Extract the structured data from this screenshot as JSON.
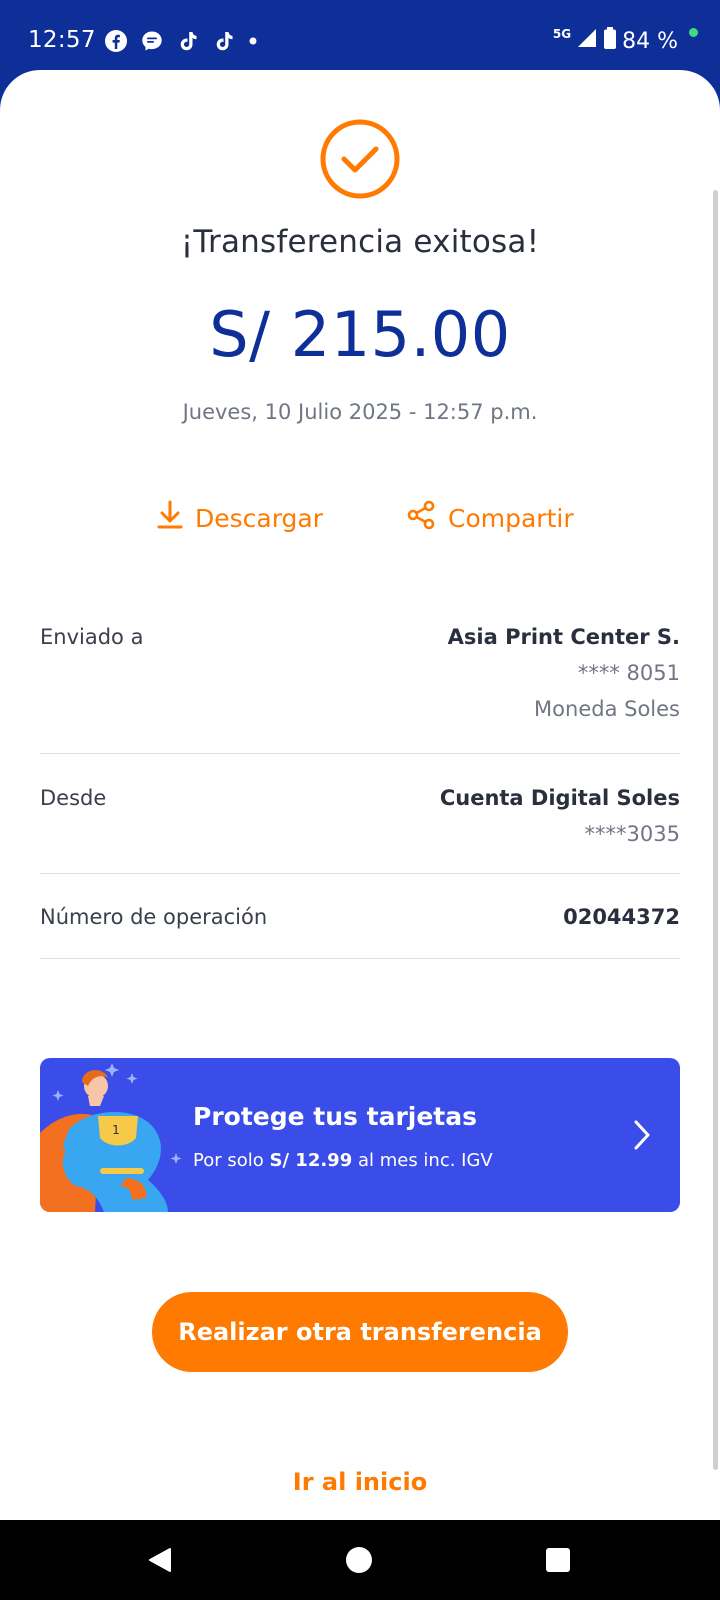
{
  "status_bar": {
    "time": "12:57",
    "network": "5G",
    "battery": "84 %",
    "notification_icons": [
      "facebook-icon",
      "messenger-icon",
      "tiktok-icon",
      "tiktok-icon",
      "dot-icon"
    ]
  },
  "receipt": {
    "title": "¡Transferencia exitosa!",
    "amount": "S/ 215.00",
    "datetime": "Jueves, 10 Julio 2025 - 12:57 p.m.",
    "actions": {
      "download_label": "Descargar",
      "share_label": "Compartir"
    },
    "details": {
      "sent_to": {
        "label": "Enviado a",
        "name": "Asia Print Center S.",
        "account": "**** 8051",
        "currency": "Moneda Soles"
      },
      "from": {
        "label": "Desde",
        "account_name": "Cuenta Digital Soles",
        "account": "****3035"
      },
      "operation": {
        "label": "Número de operación",
        "number": "02044372"
      }
    }
  },
  "promo": {
    "title": "Protege tus tarjetas",
    "sub_prefix": "Por solo ",
    "sub_price": "S/ 12.99",
    "sub_suffix": " al mes inc. IGV"
  },
  "buttons": {
    "another_transfer": "Realizar otra transferencia",
    "go_home": "Ir al inicio"
  },
  "colors": {
    "brand_blue": "#0d2f97",
    "accent_orange": "#ff7a00",
    "promo_blue": "#3b4de8"
  }
}
